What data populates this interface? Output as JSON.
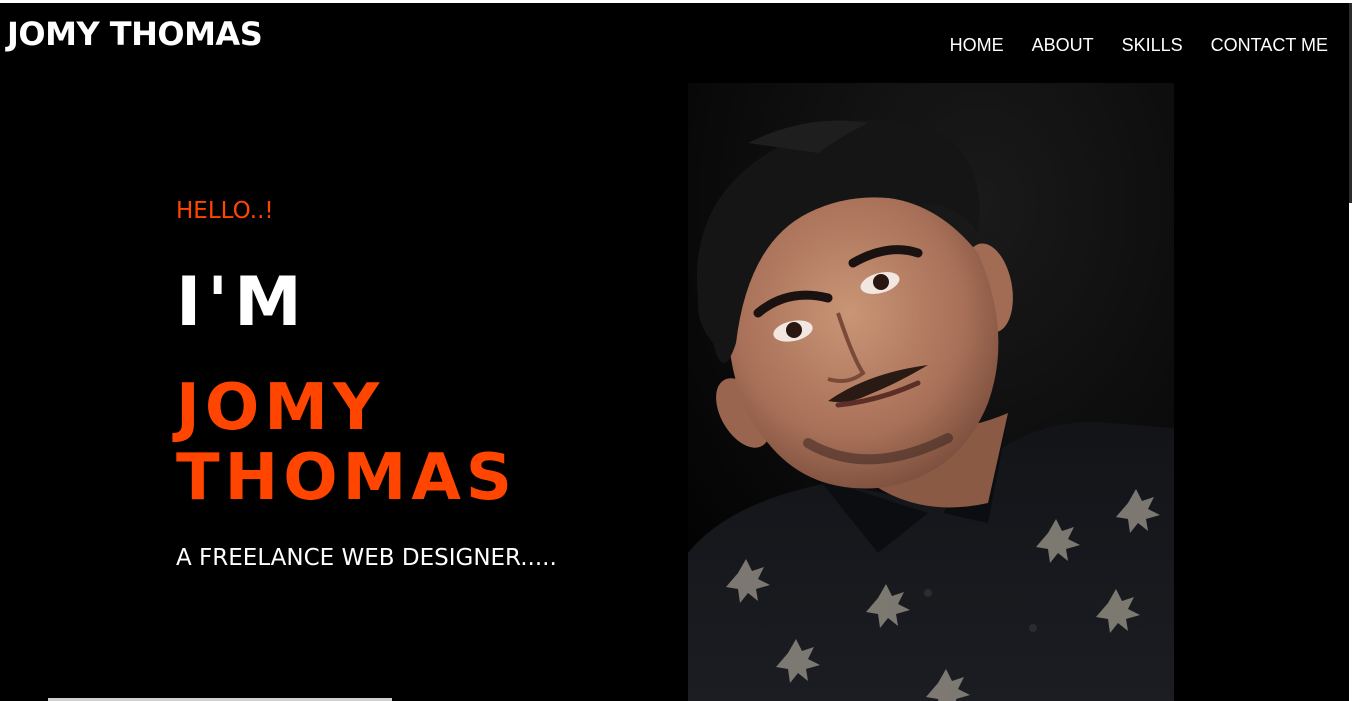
{
  "header": {
    "brand": "JOMY THOMAS"
  },
  "nav": {
    "items": [
      "HOME",
      "ABOUT",
      "SKILLS",
      "CONTACT ME"
    ]
  },
  "hero": {
    "greeting": "HELLO..!",
    "intro": "I'M",
    "name": "JOMY THOMAS",
    "tagline": "A FREELANCE WEB DESIGNER.....",
    "photo_alt": "portrait"
  },
  "colors": {
    "background": "#000000",
    "accent": "#ff4500",
    "text": "#ffffff"
  }
}
